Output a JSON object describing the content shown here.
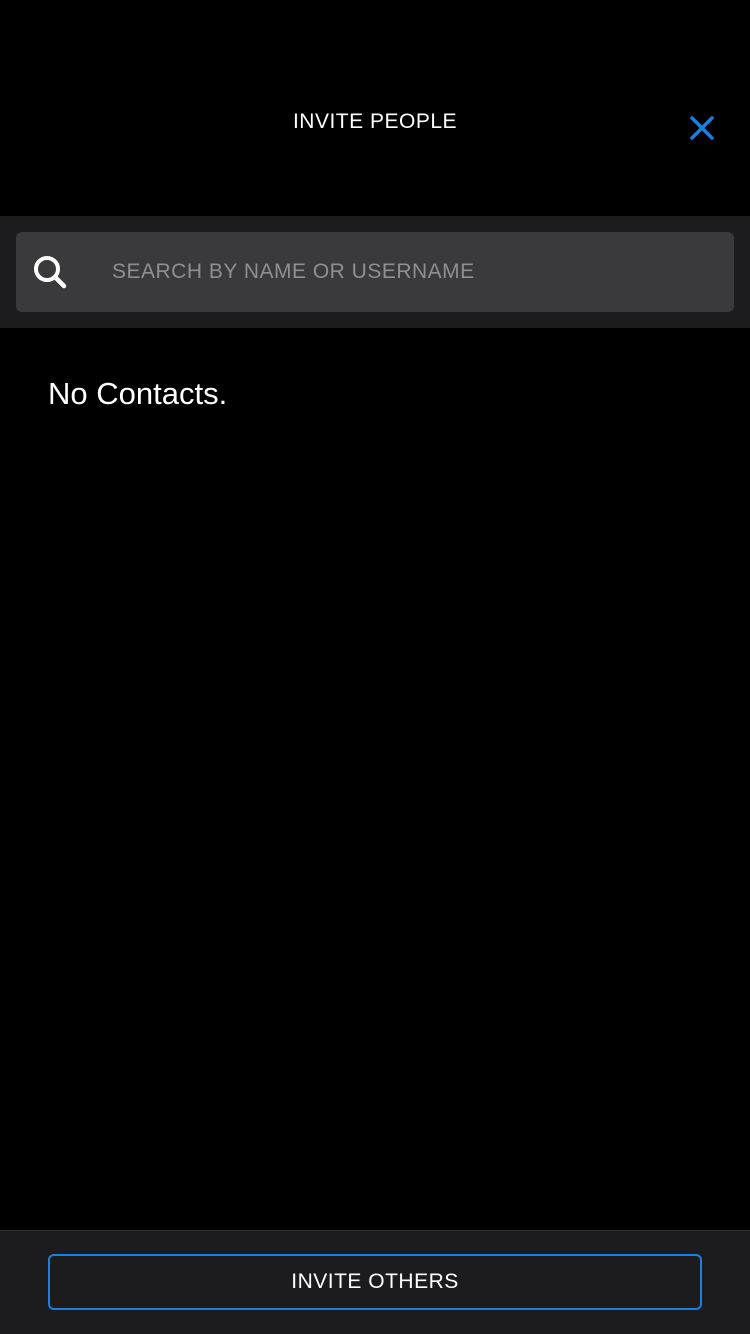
{
  "header": {
    "title": "INVITE PEOPLE",
    "close_icon": "close-icon"
  },
  "search": {
    "icon": "search-icon",
    "placeholder": "SEARCH BY NAME OR USERNAME",
    "value": ""
  },
  "contacts": {
    "empty_message": "No Contacts."
  },
  "footer": {
    "invite_others_label": "INVITE OTHERS"
  },
  "colors": {
    "background": "#000000",
    "accent": "#1a7fe0",
    "search_field": "#3a3a3c",
    "bar_background": "#1c1c1e",
    "placeholder": "#8e8e93"
  }
}
